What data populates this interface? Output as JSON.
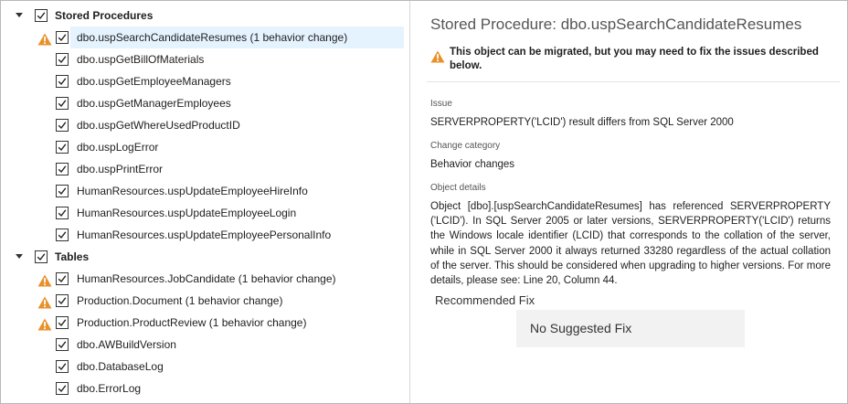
{
  "tree": {
    "groups": [
      {
        "label": "Stored Procedures",
        "items": [
          {
            "label": "dbo.uspSearchCandidateResumes (1 behavior change)",
            "warning": true,
            "selected": true
          },
          {
            "label": "dbo.uspGetBillOfMaterials",
            "warning": false
          },
          {
            "label": "dbo.uspGetEmployeeManagers",
            "warning": false
          },
          {
            "label": "dbo.uspGetManagerEmployees",
            "warning": false
          },
          {
            "label": "dbo.uspGetWhereUsedProductID",
            "warning": false
          },
          {
            "label": "dbo.uspLogError",
            "warning": false
          },
          {
            "label": "dbo.uspPrintError",
            "warning": false
          },
          {
            "label": "HumanResources.uspUpdateEmployeeHireInfo",
            "warning": false
          },
          {
            "label": "HumanResources.uspUpdateEmployeeLogin",
            "warning": false
          },
          {
            "label": "HumanResources.uspUpdateEmployeePersonalInfo",
            "warning": false
          }
        ]
      },
      {
        "label": "Tables",
        "items": [
          {
            "label": "HumanResources.JobCandidate (1 behavior change)",
            "warning": true
          },
          {
            "label": "Production.Document (1 behavior change)",
            "warning": true
          },
          {
            "label": "Production.ProductReview (1 behavior change)",
            "warning": true
          },
          {
            "label": "dbo.AWBuildVersion",
            "warning": false
          },
          {
            "label": "dbo.DatabaseLog",
            "warning": false
          },
          {
            "label": "dbo.ErrorLog",
            "warning": false
          }
        ]
      }
    ]
  },
  "detail": {
    "title": "Stored Procedure: dbo.uspSearchCandidateResumes",
    "banner_text": "This object can be migrated, but you may need to fix the issues described below.",
    "issue_label": "Issue",
    "issue_value": "SERVERPROPERTY('LCID') result differs from SQL Server 2000",
    "category_label": "Change category",
    "category_value": "Behavior changes",
    "details_label": "Object details",
    "details_text": "Object [dbo].[uspSearchCandidateResumes] has referenced SERVERPROPERTY ('LCID'). In SQL Server 2005 or later versions, SERVERPROPERTY('LCID') returns the Windows locale identifier (LCID) that corresponds to the collation of the server, while in SQL Server 2000 it always returned 33280 regardless of the actual collation of the server. This should be considered when upgrading to higher versions. For more details, please see: Line 20, Column 44.",
    "recommended_fix_label": "Recommended Fix",
    "recommended_fix_value": "No Suggested Fix"
  },
  "colors": {
    "warning": "#e8912b",
    "selection": "#e5f3ff"
  }
}
